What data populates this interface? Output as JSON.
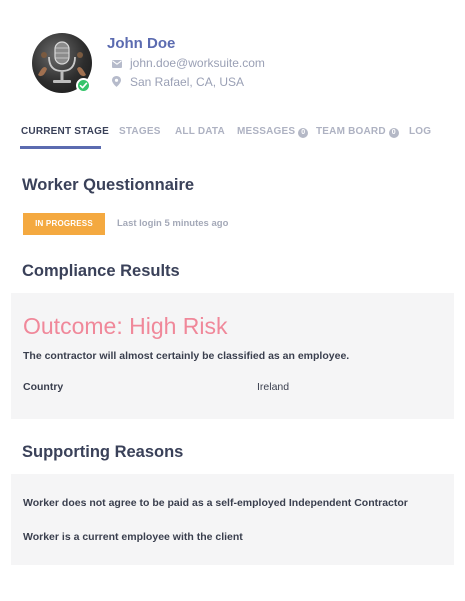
{
  "profile": {
    "name": "John Doe",
    "email": "john.doe@worksuite.com",
    "location": "San Rafael, CA, USA",
    "verified": true
  },
  "tabs": [
    {
      "label": "CURRENT STAGE",
      "active": true
    },
    {
      "label": "STAGES"
    },
    {
      "label": "ALL DATA"
    },
    {
      "label": "MESSAGES",
      "count": "0"
    },
    {
      "label": "TEAM BOARD",
      "count": "0"
    },
    {
      "label": "LOG"
    }
  ],
  "questionnaire": {
    "title": "Worker Questionnaire",
    "status": "IN PROGRESS",
    "last_login": "Last login 5 minutes ago"
  },
  "compliance": {
    "title": "Compliance Results",
    "outcome": "Outcome: High Risk",
    "description": "The contractor will almost certainly be classified as an employee.",
    "country_label": "Country",
    "country_value": "Ireland"
  },
  "supporting": {
    "title": "Supporting Reasons",
    "reasons": [
      "Worker does not agree to be paid as a self-employed Independent Contractor",
      "Worker is a current employee with the client"
    ]
  },
  "colors": {
    "accent": "#5b6bb0",
    "status": "#f4a940",
    "risk": "#f0889a",
    "verified": "#34c46a"
  }
}
